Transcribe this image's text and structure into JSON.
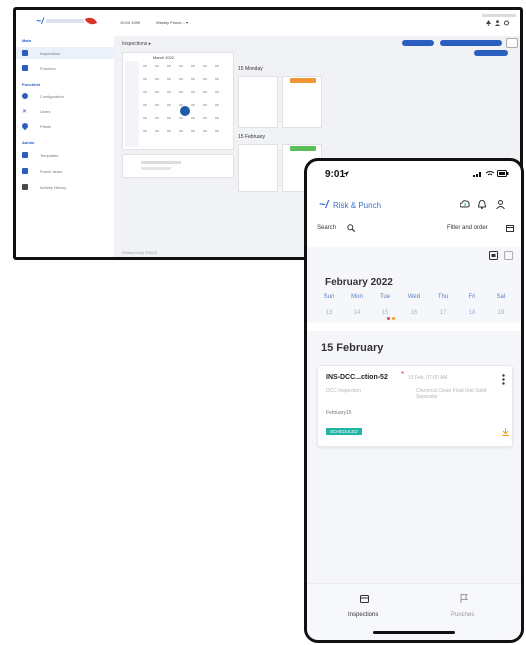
{
  "desktop": {
    "toolbar": {
      "date_text": "10:00 1999",
      "project_text": "Weekly Punch... ▾"
    },
    "main_title": "Inspections ▸",
    "sidebar": {
      "items": [
        {
          "label": "Inspections"
        },
        {
          "label": "Punches"
        },
        {
          "label": "Configuration"
        },
        {
          "label": "Users"
        },
        {
          "label": "Plants"
        },
        {
          "label": "Templates"
        },
        {
          "label": "Punch Items"
        },
        {
          "label": "Activity History"
        }
      ]
    },
    "calendar_month": "March 2022",
    "day_columns": [
      {
        "heading": "15 Monday"
      },
      {
        "heading": "15 February"
      }
    ],
    "footer_text": "Shirley Kelly ©2023"
  },
  "phone": {
    "status": {
      "time": "9:01"
    },
    "app_name": "Risk & Punch",
    "search_label": "Search",
    "filter_label": "Filter and order",
    "month_label": "February 2022",
    "weekdays": [
      "Sun",
      "Mon",
      "Tue",
      "Wed",
      "Thu",
      "Fri",
      "Sat"
    ],
    "days": [
      "13",
      "14",
      "15",
      "16",
      "17",
      "18",
      "19"
    ],
    "date_heading": "15 February",
    "card": {
      "title": "INS-DCC...ction-52",
      "datetime": "15 Feb, 07:00 AM",
      "type": "DCC Inspection",
      "plant": "Chemical Clean Fluid Unit Solid Separator",
      "name": "February15",
      "status": "SCHEDULED"
    },
    "nav": {
      "inspections": "Inspections",
      "punches": "Punches"
    },
    "colors": {
      "accent": "#2a5fbf",
      "scheduled": "#1fb5a5",
      "dot_red": "#e0473c",
      "dot_orange": "#f0a020"
    }
  }
}
